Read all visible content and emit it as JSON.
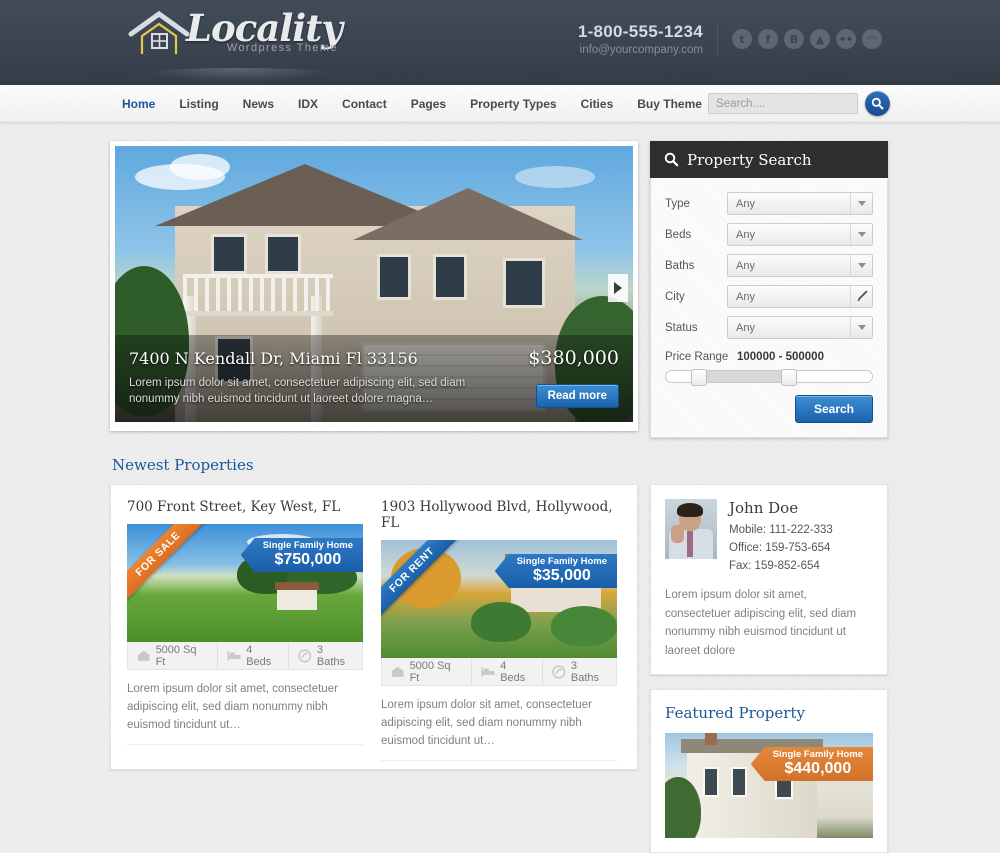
{
  "header": {
    "logo_name": "Locality",
    "logo_sub": "Wordpress Theme",
    "phone": "1-800-555-1234",
    "email": "info@yourcompany.com",
    "socials": [
      {
        "name": "twitter-icon",
        "glyph": "t"
      },
      {
        "name": "facebook-icon",
        "glyph": "f"
      },
      {
        "name": "blogger-icon",
        "glyph": "B"
      },
      {
        "name": "dropbox-icon",
        "glyph": "▲"
      },
      {
        "name": "flickr-icon",
        "glyph": "••"
      },
      {
        "name": "rss-icon",
        "glyph": "◠"
      }
    ]
  },
  "nav": {
    "items": [
      {
        "label": "Home",
        "active": true
      },
      {
        "label": "Listing",
        "active": false
      },
      {
        "label": "News",
        "active": false
      },
      {
        "label": "IDX",
        "active": false
      },
      {
        "label": "Contact",
        "active": false
      },
      {
        "label": "Pages",
        "active": false
      },
      {
        "label": "Property Types",
        "active": false
      },
      {
        "label": "Cities",
        "active": false
      },
      {
        "label": "Buy Theme",
        "active": false
      }
    ],
    "search_placeholder": "Search....",
    "search_value": ""
  },
  "slider": {
    "address": "7400 N Kendall Dr, Miami Fl 33156",
    "price": "$380,000",
    "description": "Lorem ipsum dolor sit amet, consectetuer adipiscing elit, sed diam nonummy nibh euismod tincidunt ut laoreet dolore magna…",
    "read_more": "Read more"
  },
  "property_search": {
    "title": "Property Search",
    "fields": [
      {
        "label": "Type",
        "value": "Any",
        "icon": "chevron-down-icon"
      },
      {
        "label": "Beds",
        "value": "Any",
        "icon": "chevron-down-icon"
      },
      {
        "label": "Baths",
        "value": "Any",
        "icon": "chevron-down-icon"
      },
      {
        "label": "City",
        "value": "Any",
        "icon": "location-pin-icon"
      },
      {
        "label": "Status",
        "value": "Any",
        "icon": "chevron-down-icon"
      }
    ],
    "price_range_label": "Price Range",
    "price_range_value": "100000 - 500000",
    "price_min": 100000,
    "price_max": 500000,
    "submit_label": "Search"
  },
  "newest": {
    "section_title": "Newest Properties",
    "properties": [
      {
        "address": "700 Front Street, Key West, FL",
        "type": "Single Family Home",
        "price": "$750,000",
        "status_ribbon": "FOR SALE",
        "ribbon_color": "#e4883c",
        "sqft": "5000 Sq Ft",
        "beds": "4 Beds",
        "baths": "3 Baths",
        "description": "Lorem ipsum dolor sit amet, consectetuer adipiscing elit, sed diam nonummy nibh euismod tincidunt ut…"
      },
      {
        "address": "1903 Hollywood Blvd, Hollywood, FL",
        "type": "Single Family Home",
        "price": "$35,000",
        "status_ribbon": "FOR RENT",
        "ribbon_color": "#2f7cc6",
        "sqft": "5000 Sq Ft",
        "beds": "4 Beds",
        "baths": "3 Baths",
        "description": "Lorem ipsum dolor sit amet, consectetuer adipiscing elit, sed diam nonummy nibh euismod tincidunt ut…"
      }
    ]
  },
  "agent": {
    "name": "John Doe",
    "mobile": "Mobile: 111-222-333",
    "office": "Office: 159-753-654",
    "fax": "Fax: 159-852-654",
    "bio": "Lorem ipsum dolor sit amet, consectetuer adipiscing elit, sed diam nonummy nibh euismod tincidunt ut laoreet dolore"
  },
  "featured": {
    "title": "Featured Property",
    "type": "Single Family Home",
    "price": "$440,000"
  },
  "colors": {
    "header_bg": "#39424e",
    "accent_blue": "#1a5699",
    "button_blue": "#1a62ad",
    "orange": "#e4883c",
    "page_bg": "#ededed"
  }
}
